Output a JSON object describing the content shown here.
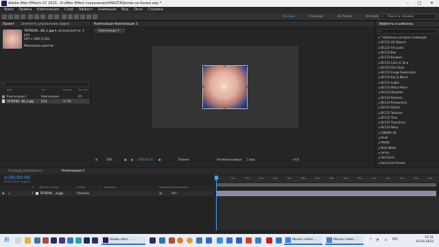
{
  "title_bar": {
    "title": "Adobe After Effects CC 2015 - D:\\After Effect сохранения\\РАБОТА\\Битва на Калке.aep *"
  },
  "menu": [
    "Файл",
    "Правка",
    "Композиция",
    "Слой",
    "Эффект",
    "Анимация",
    "Вид",
    "Окно",
    "Справка"
  ],
  "workspaces": {
    "items": [
      "Основы",
      "Стандарт",
      "All Panels",
      "Animation"
    ],
    "active": "Основы"
  },
  "search_help": {
    "placeholder": "Поиск в справке"
  },
  "project_panel": {
    "tabs": [
      "Проект",
      "Элементы управления эффек"
    ],
    "thumb_name": "7670240...82_n.jpg ▾",
    "thumb_use": ", используется: 1 раз",
    "thumb_dims": "297 x 268 (1,00)",
    "thumb_color": "Миллионы цветов",
    "columns": [
      "Имя",
      "Тип",
      "Размер",
      "Частота"
    ],
    "items": [
      {
        "name": "Композиция 1",
        "type": "Композиция",
        "size": "",
        "rate": "25"
      },
      {
        "name": "7670240...82_n.jpg",
        "type": "JPEG",
        "size": "37 КБ",
        "rate": ""
      }
    ],
    "footer": "8 бит на канал"
  },
  "comp_panel": {
    "tab": "Композиция Композиция 1",
    "subtab": "Композиция 1",
    "zoom": "50%",
    "timecode": "0:00:00:00",
    "resolution": "Полное",
    "camera": "Активная камера",
    "views": "1 вид",
    "exposure": "+0,0"
  },
  "effects_panel": {
    "title": "Эффекты и шаблоны",
    "items": [
      "* Шаблоны настроек анимации",
      "BCC10 3D Objects",
      "BCC10 Art Looks",
      "BCC10 Blur",
      "BCC10 Browser",
      "BCC10 Color & Tone",
      "BCC10 Film Style",
      "BCC10 Image Restoration",
      "BCC10 Key & Blend",
      "BCC10 Lights",
      "BCC10 Match Move",
      "BCC10 Obsolete",
      "BCC10 Particles",
      "BCC10 Perspective",
      "BCC10 Stylize",
      "BCC10 Textures",
      "BCC10 Time",
      "BCC10 Transitions",
      "BCC10 Warp",
      "CINEMA 4D",
      "Knoll",
      "Mettle",
      "Noel Welsh",
      "omino",
      "Red Giant",
      "Red Giant Presets"
    ]
  },
  "timeline": {
    "tabs": [
      "Очередь рендеринга",
      "Композиция 1"
    ],
    "timecode": "0:00:00:00",
    "fps": "00000 (25,00 кадр/с)",
    "columns": [
      "#",
      "Имя источника",
      "Режим",
      "T",
      "Дорожка",
      "Родительский элемент"
    ],
    "layer": {
      "num": "1",
      "name": "7670240..._n.jpg",
      "mode": "Нормаль",
      "parent": "Нет"
    },
    "ruler_ticks": [
      "0s",
      "01s",
      "02s",
      "03s",
      "04s",
      "05s",
      "06s",
      "07s",
      "08s",
      "09s",
      "10s",
      "11s",
      "12s",
      "13s",
      "14s",
      "15s"
    ]
  },
  "taskbar": {
    "apps": [
      {
        "label": "Adobe After ..."
      },
      {
        "label": "Movavi Video ..."
      },
      {
        "label": "Movavi Video ..."
      }
    ],
    "lang": "РУС",
    "time": "15:31",
    "date": "16.04.2023"
  }
}
